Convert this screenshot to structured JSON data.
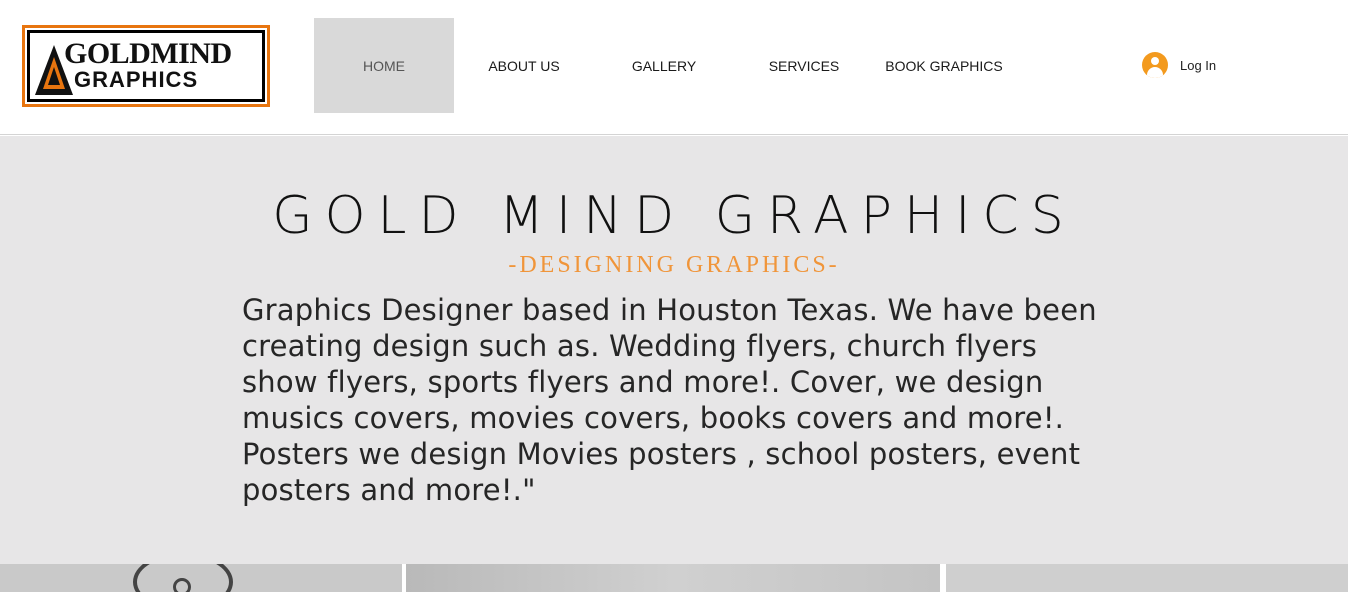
{
  "logo": {
    "line1": "GOLDMIND",
    "line2": "GRAPHICS",
    "colors": {
      "accent": "#e8750f",
      "frame": "#000000"
    }
  },
  "nav": {
    "items": [
      {
        "label": "HOME",
        "active": true
      },
      {
        "label": "ABOUT US",
        "active": false
      },
      {
        "label": "GALLERY",
        "active": false
      },
      {
        "label": "SERVICES",
        "active": false
      },
      {
        "label": "BOOK GRAPHICS",
        "active": false
      }
    ]
  },
  "login": {
    "label": "Log In",
    "icon": "user-avatar-icon",
    "color": "#f39a1e"
  },
  "hero": {
    "title": "GOLD MIND GRAPHICS",
    "subtitle": "-DESIGNING GRAPHICS-",
    "body": "Graphics Designer based in Houston Texas. We have been creating design such as. Wedding flyers, church flyers show flyers, sports flyers and more!. Cover, we design musics covers, movies covers, books covers and more!. Posters we design Movies posters , school posters, event posters and more!.\"",
    "background": "#e7e6e7",
    "subtitle_color": "#f0953a"
  }
}
